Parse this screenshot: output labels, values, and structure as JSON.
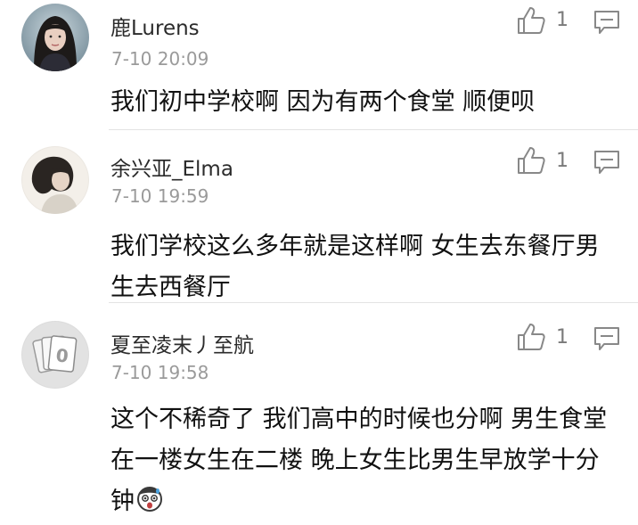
{
  "comments": [
    {
      "username": "鹿Lurens",
      "timestamp": "7-10 20:09",
      "like_count": "1",
      "text": "我们初中学校啊 因为有两个食堂 顺便呗",
      "avatar_icon": "woman-portrait-icon"
    },
    {
      "username": "余兴亚_Elma",
      "timestamp": "7-10 19:59",
      "like_count": "1",
      "text": "我们学校这么多年就是这样啊 女生去东餐厅男生去西餐厅",
      "avatar_icon": "woman-profile-portrait-icon"
    },
    {
      "username": "夏至凌末丿至航",
      "timestamp": "7-10 19:58",
      "like_count": "1",
      "text": "这个不稀奇了 我们高中的时候也分啊 男生食堂在一楼女生在二楼 晚上女生比男生早放学十分钟",
      "avatar_icon": "uno-cards-icon",
      "trailing_emoji": "surprised-face-emoji"
    }
  ],
  "icons": {
    "like": "thumbs-up-icon",
    "reply": "comment-bubble-icon"
  }
}
